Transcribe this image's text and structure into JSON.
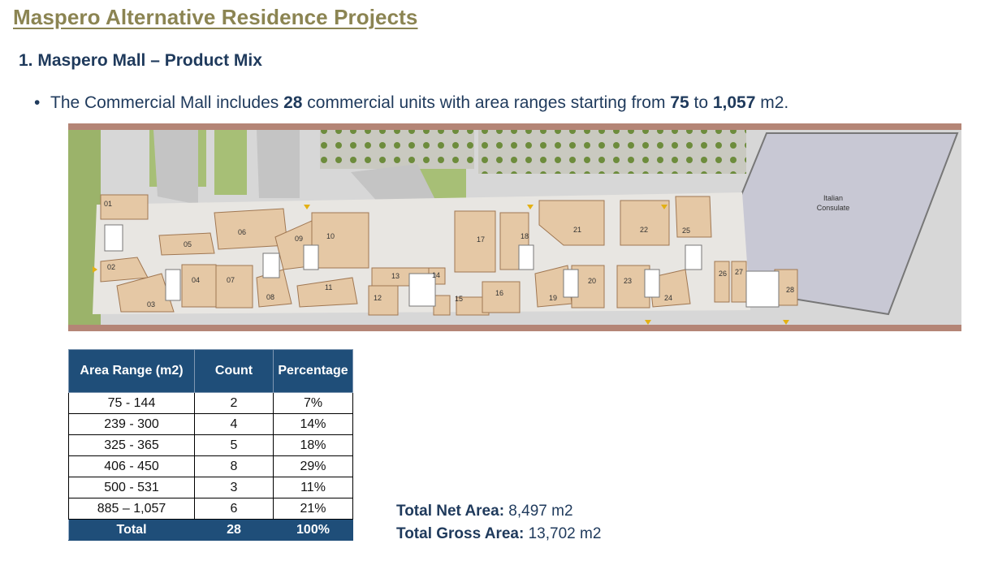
{
  "title": "Maspero Alternative Residence Projects",
  "subtitle": "1. Maspero Mall – Product Mix",
  "bullet": {
    "pre": "The Commercial Mall includes ",
    "units": "28",
    "mid": " commercial units with area ranges starting from ",
    "min": "75",
    "to": " to ",
    "max": "1,057",
    "post": " m2."
  },
  "plan": {
    "consulate_line1": "Italian",
    "consulate_line2": "Consulate",
    "units": [
      "01",
      "02",
      "03",
      "04",
      "05",
      "06",
      "07",
      "08",
      "09",
      "10",
      "11",
      "12",
      "13",
      "14",
      "15",
      "16",
      "17",
      "18",
      "19",
      "20",
      "21",
      "22",
      "23",
      "24",
      "25",
      "26",
      "27",
      "28"
    ]
  },
  "table": {
    "headers": [
      "Area Range (m2)",
      "Count",
      "Percentage"
    ],
    "rows": [
      [
        "75 - 144",
        "2",
        "7%"
      ],
      [
        "239 - 300",
        "4",
        "14%"
      ],
      [
        "325 - 365",
        "5",
        "18%"
      ],
      [
        "406 - 450",
        "8",
        "29%"
      ],
      [
        "500 - 531",
        "3",
        "11%"
      ],
      [
        "885 – 1,057",
        "6",
        "21%"
      ]
    ],
    "total": [
      "Total",
      "28",
      "100%"
    ]
  },
  "totals": {
    "net_label": "Total Net Area:",
    "net_value": " 8,497 m2",
    "gross_label": "Total Gross Area:",
    "gross_value": " 13,702 m2"
  }
}
